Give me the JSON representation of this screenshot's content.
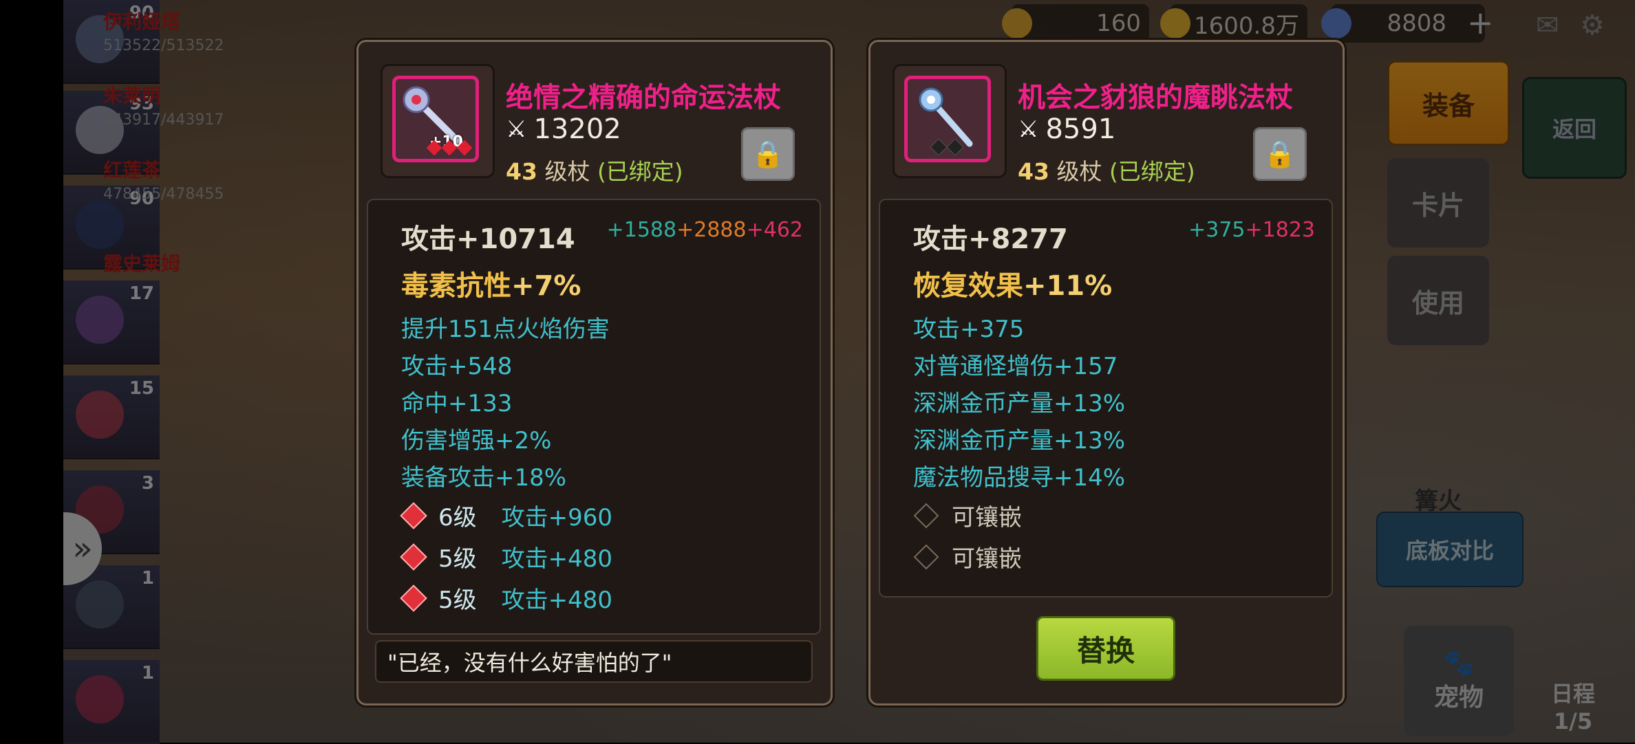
{
  "heroes": [
    {
      "level": "90",
      "name": "伊利娅塔",
      "hp": "513522/513522"
    },
    {
      "level": "93",
      "name": "朱莱明",
      "hp": "443917/443917"
    },
    {
      "level": "90",
      "name": "红莲茶",
      "hp": "478455/478455"
    },
    {
      "level": "17",
      "name": "露史莱姆",
      "hp": ""
    },
    {
      "level": "15",
      "name": "",
      "hp": ""
    },
    {
      "level": "3",
      "name": "",
      "hp": ""
    },
    {
      "level": "1",
      "name": "",
      "hp": ""
    },
    {
      "level": "1",
      "name": "",
      "hp": ""
    }
  ],
  "resources": {
    "stamina": "160",
    "gold": "1600.8万",
    "gems": "8808",
    "add": "+"
  },
  "right_menu": {
    "equip": "装备",
    "back": "返回",
    "card": "卡片",
    "use": "使用",
    "campfire": "篝火",
    "compare": "底板对比",
    "pet": "宠物",
    "schedule": "日程",
    "schedule_count": "1/5"
  },
  "left_item": {
    "name": "绝情之精确的命运法杖",
    "power": "13202",
    "level": "43",
    "level_text": "级杖",
    "bound": "(已绑定)",
    "enhance": "+10",
    "main_stat": "攻击+10714",
    "extra": [
      "+1588",
      "+2888",
      "+462"
    ],
    "special_label": "毒素抗性",
    "special_value": "+7%",
    "lines": [
      "提升151点火焰伤害",
      "攻击+548",
      "命中+133",
      "伤害增强+2%",
      "装备攻击+18%"
    ],
    "gems": [
      {
        "lv": "6级",
        "stat": "攻击+960"
      },
      {
        "lv": "5级",
        "stat": "攻击+480"
      },
      {
        "lv": "5级",
        "stat": "攻击+480"
      }
    ],
    "quote": "\"已经，没有什么好害怕的了\""
  },
  "right_item": {
    "name": "机会之豺狼的魔眺法杖",
    "power": "8591",
    "level": "43",
    "level_text": "级杖",
    "bound": "(已绑定)",
    "main_stat": "攻击+8277",
    "extra": [
      "+375",
      "+1823"
    ],
    "special_label": "恢复效果",
    "special_value": "+11%",
    "lines": [
      "攻击+375",
      "对普通怪增伤+157",
      "深渊金币产量+13%",
      "深渊金币产量+13%",
      "魔法物品搜寻+14%"
    ],
    "sockets": [
      "可镶嵌",
      "可镶嵌"
    ],
    "replace": "替换"
  },
  "colors": {
    "item_name": "#f0208a",
    "stat_cyan": "#40c0cc",
    "special": "#f2c04a",
    "bound": "#a8d050",
    "replace": "#9cc830"
  }
}
